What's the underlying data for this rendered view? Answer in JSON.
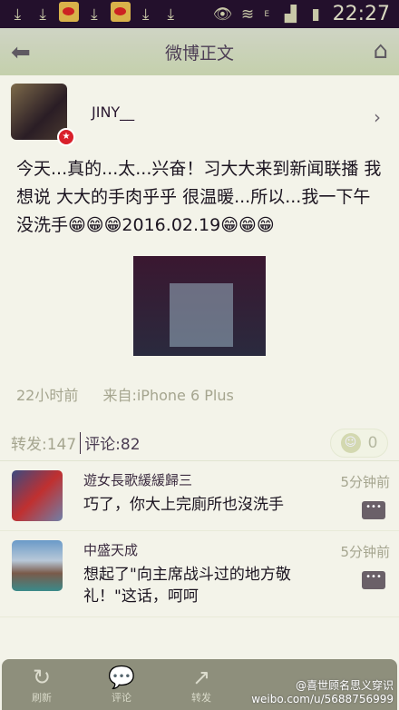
{
  "status_bar": {
    "time": "22:27",
    "network": "E",
    "icons": [
      "download-icon",
      "download-icon",
      "weibo-icon",
      "download-icon",
      "weibo-icon",
      "download-icon",
      "download-icon",
      "eye-icon",
      "wifi-icon",
      "signal-icon",
      "battery-icon"
    ]
  },
  "nav": {
    "title": "微博正文",
    "back_icon": "arrow-left-icon",
    "home_icon": "home-icon"
  },
  "post": {
    "username": "JINY__",
    "text": "今天...真的...太...兴奋！习大大来到新闻联播 我想说 大大的手肉乎乎 很温暖...所以...我一下午没洗手😁😁😁2016.02.19😁😁😁",
    "time": "22小时前",
    "source": "来自:iPhone 6 Plus"
  },
  "stats": {
    "reposts": "转发:147",
    "comments": "评论:82",
    "likes": "0"
  },
  "comments": [
    {
      "name": "遊女長歌緩緩歸三",
      "text": "巧了，你大上完廁所也沒洗手",
      "time": "5分钟前"
    },
    {
      "name": "中盛天成",
      "text": "想起了\"向主席战斗过的地方敬礼！\"这话，呵呵",
      "time": "5分钟前"
    }
  ],
  "toolbar": {
    "refresh": "刷新",
    "comment": "评论",
    "repost": "转发"
  },
  "watermark": {
    "handle": "@喜世顾名思义穿识",
    "url": "weibo.com/u/5688756999"
  }
}
